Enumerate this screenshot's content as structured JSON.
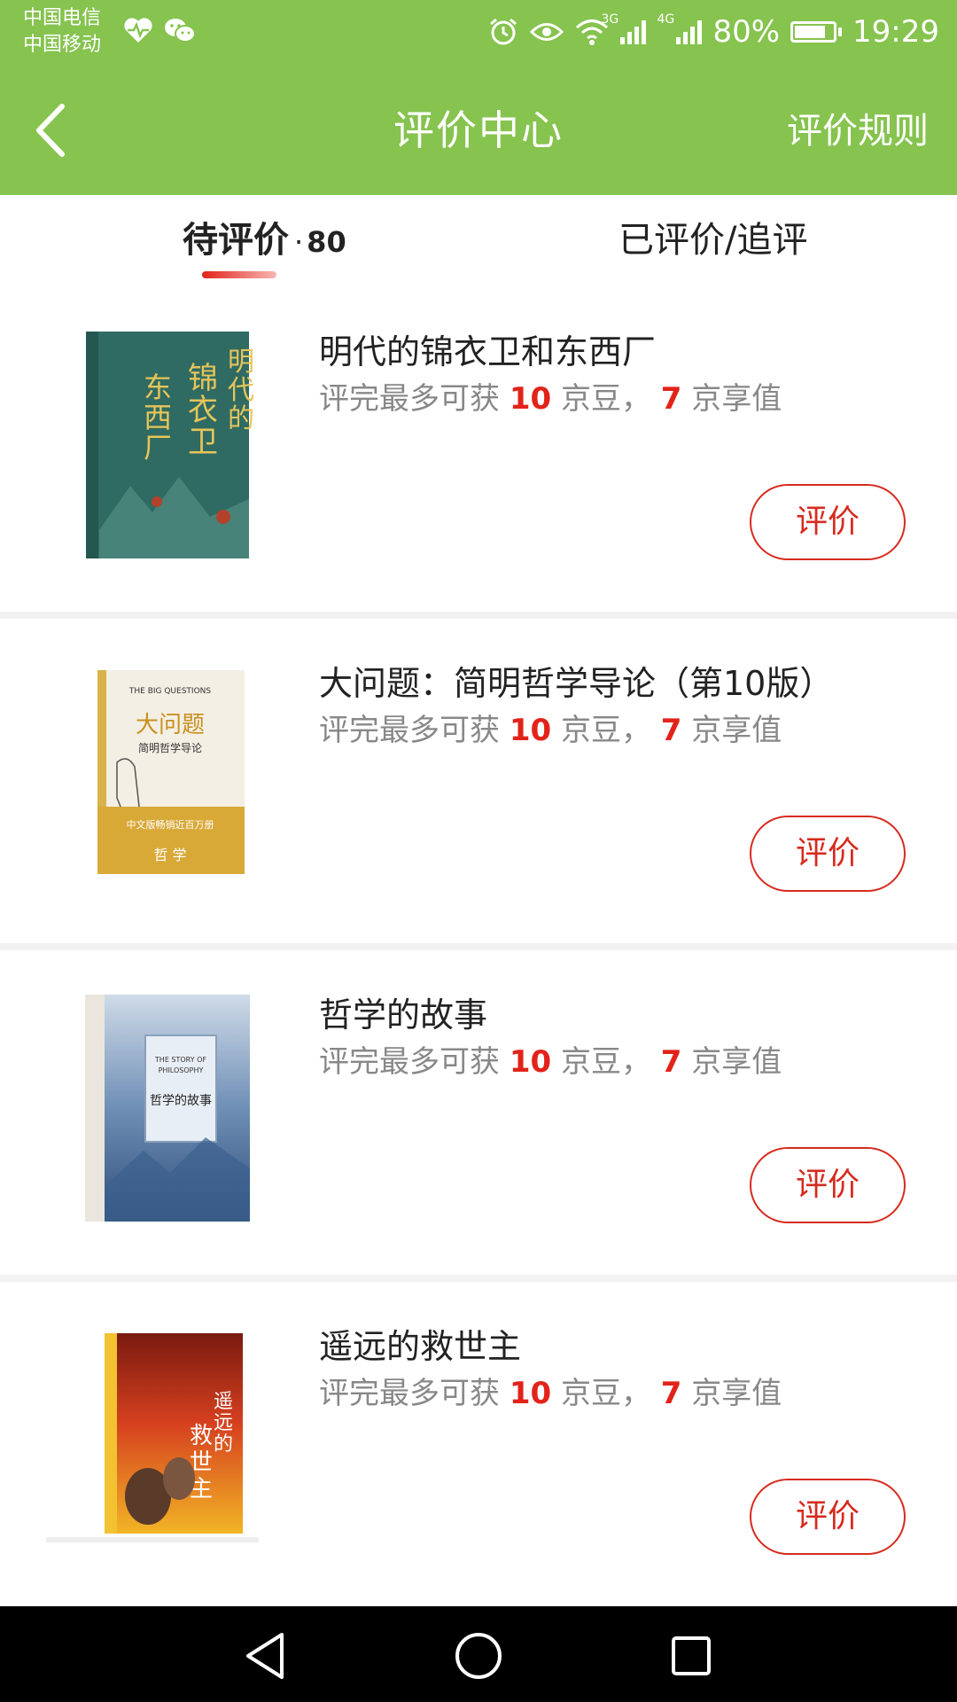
{
  "status_bar": {
    "carrier_1": "中国电信",
    "carrier_2": "中国移动",
    "net_1": "3G",
    "net_2": "4G",
    "battery": "80%",
    "battery_level": 0.8,
    "time": "19:29",
    "icons": [
      "heartbeat-icon",
      "wechat-icon",
      "alarm-icon",
      "eye-icon",
      "wifi-icon",
      "signal-icon",
      "battery-icon"
    ]
  },
  "header": {
    "title": "评价中心",
    "rules_link": "评价规则"
  },
  "tabs": {
    "pending_label": "待评价",
    "pending_dot": "·",
    "pending_count": "80",
    "done_label": "已评价/追评"
  },
  "reward_text": {
    "prefix": "评完最多可获",
    "beans_value": "10",
    "beans_unit": "京豆，",
    "points_value": "7",
    "points_unit": "京享值"
  },
  "items": [
    {
      "title": "明代的锦衣卫和东西厂",
      "button": "评价",
      "cover_color": "#2f6b62"
    },
    {
      "title": "大问题：简明哲学导论（第10版）",
      "button": "评价",
      "cover_color": "#f4efe4"
    },
    {
      "title": "哲学的故事",
      "button": "评价",
      "cover_color": "#6f8fb6"
    },
    {
      "title": "遥远的救世主",
      "button": "评价",
      "cover_color": "#c8351d"
    }
  ],
  "colors": {
    "header_green": "#86c34f",
    "accent_red": "#e2231a",
    "button_red": "#d62b1f"
  },
  "nav": [
    "back-triangle-icon",
    "home-circle-icon",
    "recents-square-icon"
  ]
}
